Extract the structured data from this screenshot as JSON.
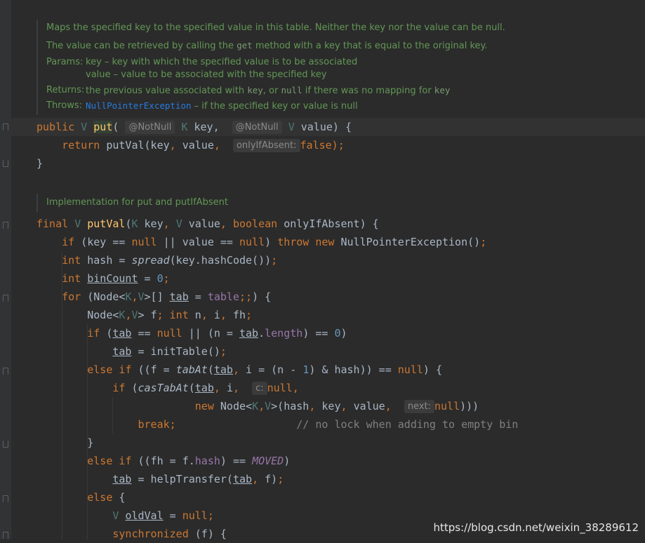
{
  "doc1": {
    "summary": "Maps the specified key to the specified value in this table. Neither the key nor the value can be null.",
    "retrieve_pre": "The value can be retrieved by calling the ",
    "retrieve_code": "get",
    "retrieve_post": " method with a key that is equal to the original key.",
    "params_label": "Params:",
    "param1": "key – key with which the specified value is to be associated",
    "param2": "value – value to be associated with the specified key",
    "returns_label": "Returns:",
    "returns_pre": "the previous value associated with ",
    "returns_key": "key",
    "returns_mid": ", or ",
    "returns_null": "null",
    "returns_post": " if there was no mapping for ",
    "returns_key2": "key",
    "throws_label": "Throws:",
    "throws_link": "NullPointerException",
    "throws_text": " – if the specified key or value is null"
  },
  "doc2": {
    "text": "Implementation for put and putIfAbsent"
  },
  "hints": {
    "notnull": "@NotNull",
    "only_if_absent": "onlyIfAbsent:",
    "c": "c:",
    "next": "next:"
  },
  "watermark": "https://blog.csdn.net/weixin_38289612"
}
